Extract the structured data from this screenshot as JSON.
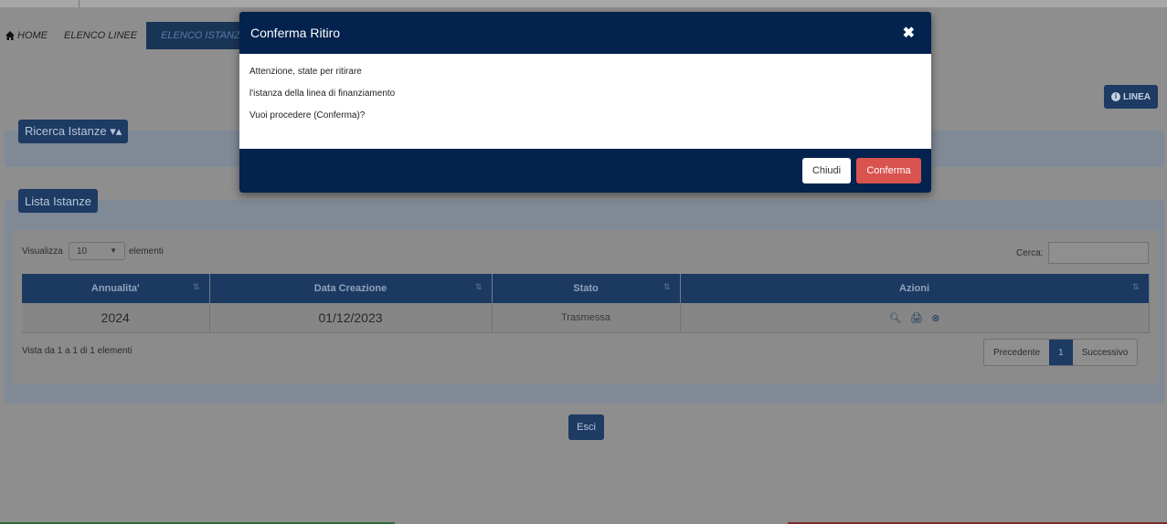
{
  "breadcrumb": {
    "home": "HOME",
    "linee": "ELENCO LINEE",
    "istanze": "ELENCO ISTANZE"
  },
  "linea_button": "LINEA",
  "ricerca": {
    "legend": "Ricerca Istanze ▾▴"
  },
  "lista": {
    "legend": "Lista Istanze",
    "visualizza_label": "Visualizza",
    "page_size": "10",
    "elementi_label": "elementi",
    "cerca_label": "Cerca:",
    "columns": [
      "Annualita'",
      "Data Creazione",
      "Stato",
      "Azioni"
    ],
    "rows": [
      {
        "annualita": "2024",
        "data_creazione": "01/12/2023",
        "stato": "Trasmessa"
      }
    ],
    "info": "Vista da 1 a 1 di 1 elementi",
    "pager": {
      "prev": "Precedente",
      "current": "1",
      "next": "Successivo"
    }
  },
  "esci": "Esci",
  "modal": {
    "title": "Conferma Ritiro",
    "lines": [
      "Attenzione, state per ritirare",
      "l'istanza della linea di finanziamento",
      "Vuoi procedere (Conferma)?"
    ],
    "chiudi": "Chiudi",
    "conferma": "Conferma"
  },
  "colors": {
    "navy": "#03224d",
    "danger": "#d9534f"
  }
}
